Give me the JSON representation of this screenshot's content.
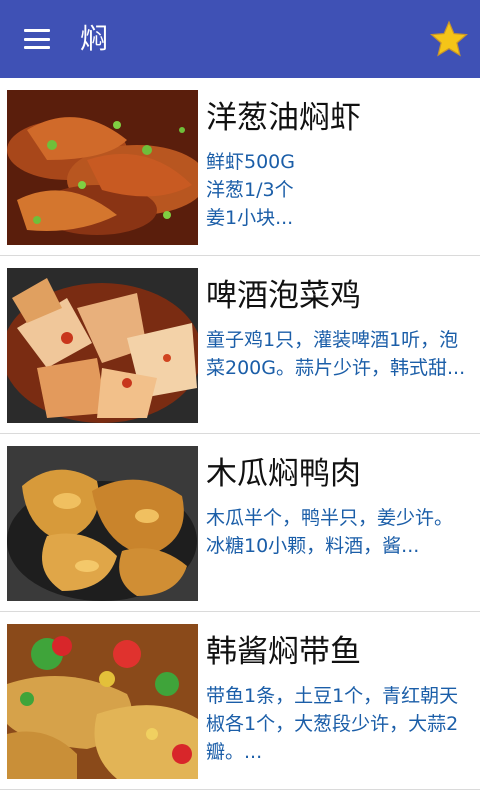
{
  "appbar": {
    "title": "焖",
    "menu_icon": "menu-icon",
    "favorite_icon": "star-icon",
    "bar_color": "#3f51b5",
    "star_color": "#f5c518"
  },
  "recipes": [
    {
      "title": "洋葱油焖虾",
      "desc": "鲜虾500G\n洋葱1/3个\n姜1小块..."
    },
    {
      "title": "啤酒泡菜鸡",
      "desc": " 童子鸡1只，灌装啤酒1听，泡菜200G。蒜片少许，韩式甜..."
    },
    {
      "title": "木瓜焖鸭肉",
      "desc": "木瓜半个，鸭半只，姜少许。\n冰糖10小颗，料酒，酱..."
    },
    {
      "title": "韩酱焖带鱼",
      "desc": "带鱼1条，土豆1个，青红朝天椒各1个，大葱段少许，大蒜2瓣。..."
    }
  ]
}
